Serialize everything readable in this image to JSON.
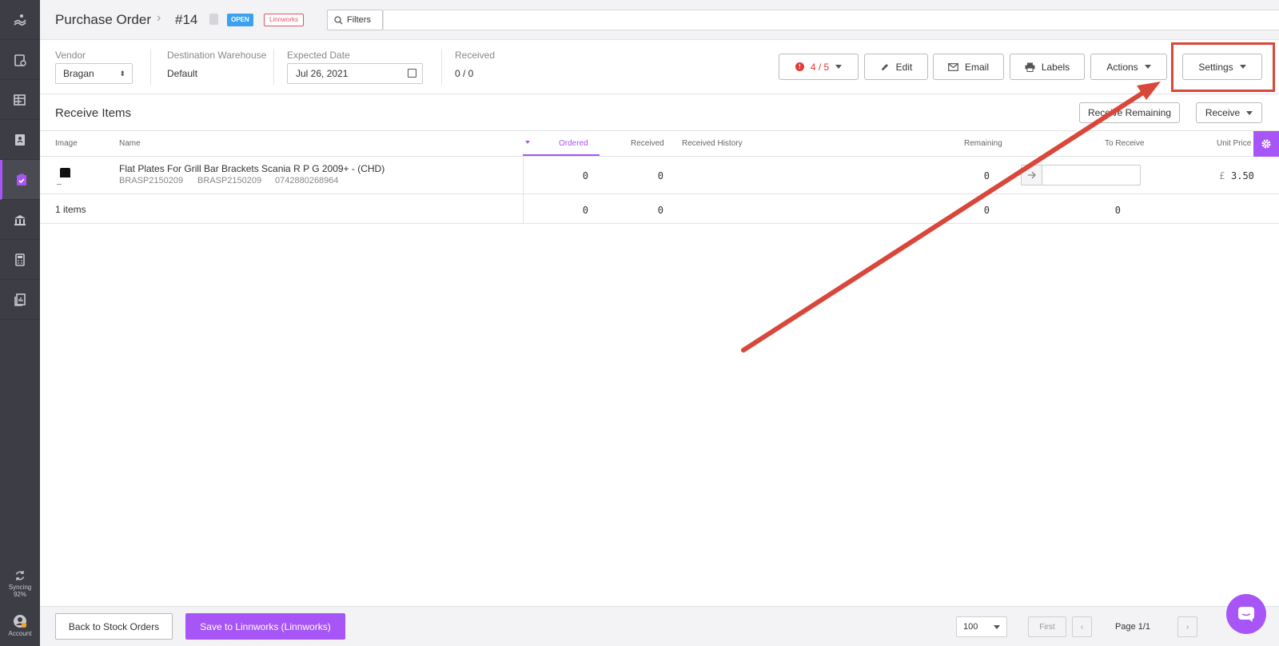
{
  "sidebar": {
    "items": [
      {
        "icon": "dashboard-icon"
      },
      {
        "icon": "orders-icon"
      },
      {
        "icon": "listings-icon"
      },
      {
        "icon": "contacts-icon"
      },
      {
        "icon": "purchase-orders-icon",
        "active": true
      },
      {
        "icon": "warehouse-icon"
      },
      {
        "icon": "calculator-icon"
      },
      {
        "icon": "reports-icon"
      }
    ],
    "sync_label": "Syncing",
    "sync_percent": "92%",
    "account_label": "Account"
  },
  "header": {
    "title": "Purchase Order",
    "number": "#14",
    "status_badge": "OPEN",
    "channel_badge": "Linnworks",
    "filters_label": "Filters"
  },
  "info": {
    "vendor_label": "Vendor",
    "vendor_value": "Bragan",
    "destination_label": "Destination Warehouse",
    "destination_value": "Default",
    "expected_label": "Expected Date",
    "expected_value": "Jul 26, 2021",
    "received_label": "Received",
    "received_value": "0 / 0"
  },
  "toolbar": {
    "warnings": "4 / 5",
    "edit": "Edit",
    "email": "Email",
    "labels": "Labels",
    "actions": "Actions",
    "settings": "Settings"
  },
  "section": {
    "title": "Receive Items",
    "receive_remaining": "Receive Remaining",
    "receive": "Receive"
  },
  "table": {
    "columns": {
      "image": "Image",
      "name": "Name",
      "ordered": "Ordered",
      "received": "Received",
      "history": "Received History",
      "remaining": "Remaining",
      "to_receive": "To Receive",
      "unit_price": "Unit Price"
    },
    "rows": [
      {
        "name": "Flat Plates For Grill Bar Brackets Scania R P G 2009+ - (CHD)",
        "sku": "BRASP2150209",
        "supplier_code": "BRASP2150209",
        "barcode": "0742880268964",
        "ordered": "0",
        "received": "0",
        "remaining": "0",
        "currency": "£",
        "unit_price": "3.50"
      }
    ],
    "totals": {
      "items": "1 items",
      "ordered": "0",
      "received": "0",
      "remaining": "0",
      "to_receive": "0"
    }
  },
  "footer": {
    "back": "Back to Stock Orders",
    "save": "Save to Linnworks (Linnworks)",
    "page_size": "100",
    "first": "First",
    "page_info": "Page 1/1"
  },
  "colors": {
    "accent": "#a855f7",
    "status_open": "#3ba1f0",
    "warning": "#e53935",
    "annotation": "#d9473a"
  }
}
